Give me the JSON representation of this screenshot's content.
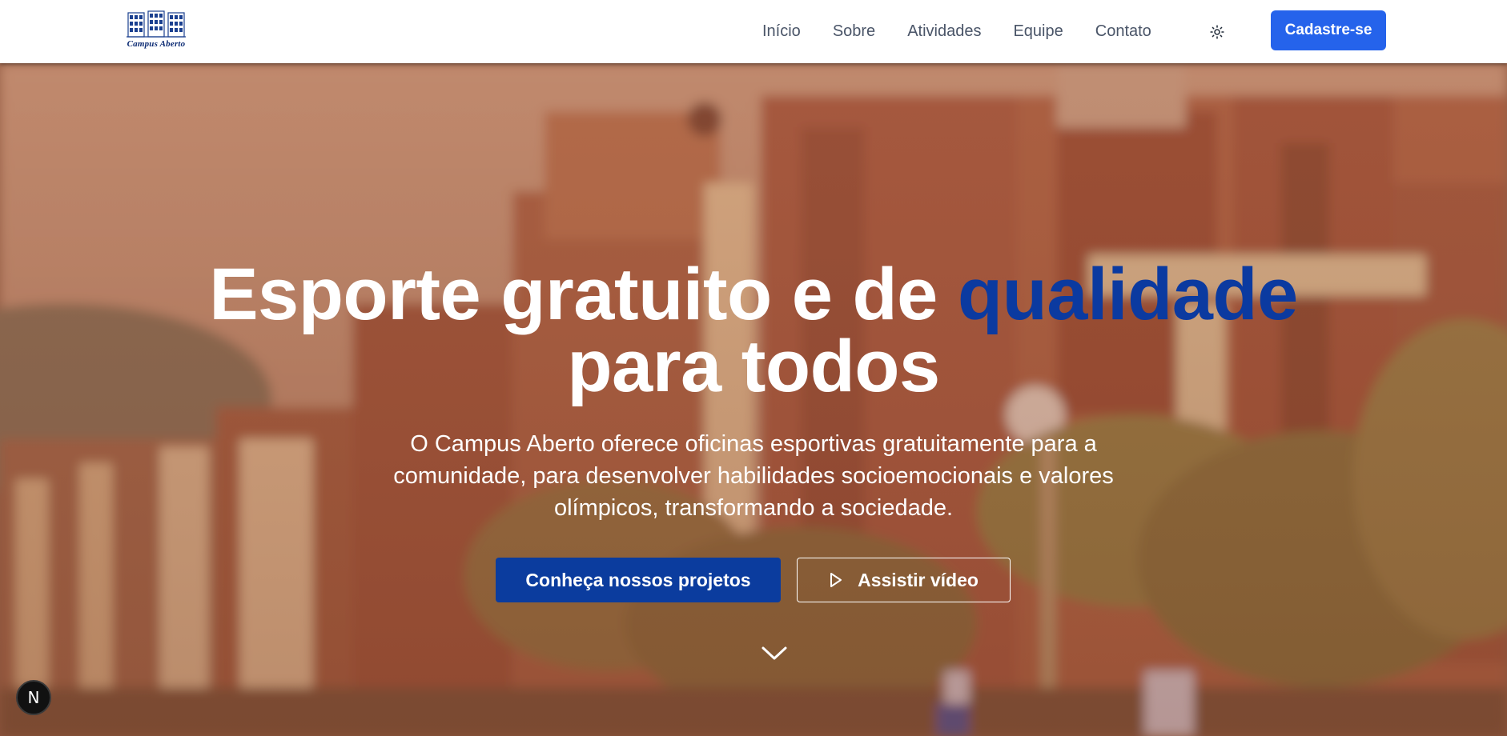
{
  "header": {
    "logo_text": "Campus Aberto",
    "nav": [
      "Início",
      "Sobre",
      "Atividades",
      "Equipe",
      "Contato"
    ],
    "theme_icon": "sun-icon",
    "signup_label": "Cadastre-se"
  },
  "hero": {
    "title_part1": "Esporte gratuito e de ",
    "title_accent": "qualidade",
    "title_part2": "para todos",
    "subtitle": "O Campus Aberto oferece oficinas esportivas gratuitamente para a comunidade, para desenvolver habilidades socioemocionais e valores olímpicos, transformando a sociedade.",
    "primary_cta": "Conheça nossos projetos",
    "secondary_cta": "Assistir vídeo",
    "secondary_icon": "play-icon",
    "scroll_icon": "chevron-down-icon"
  },
  "dev_badge": {
    "letter": "N",
    "icon": "nextjs-icon"
  },
  "colors": {
    "accent": "#0b3aa0",
    "signup": "#2563eb",
    "primary_cta": "#0b3c9e",
    "overlay": "#b06a4a"
  }
}
